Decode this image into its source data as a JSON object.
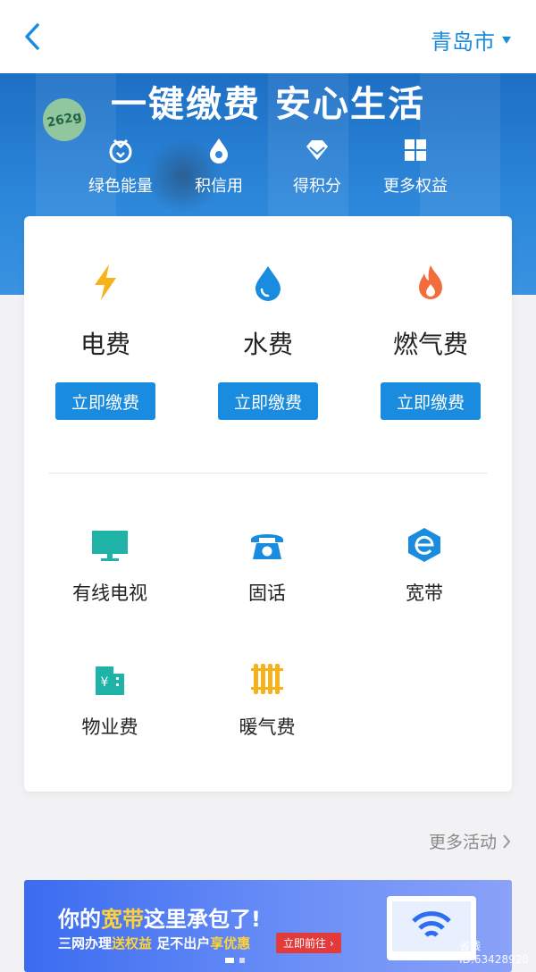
{
  "header": {
    "city": "青岛市"
  },
  "hero": {
    "badge": "262g",
    "title": "一键缴费  安心生活",
    "perks": [
      {
        "label": "绿色能量",
        "icon": "green-energy-icon"
      },
      {
        "label": "积信用",
        "icon": "credit-icon"
      },
      {
        "label": "得积分",
        "icon": "diamond-points-icon"
      },
      {
        "label": "更多权益",
        "icon": "grid-more-icon"
      }
    ]
  },
  "main_items": [
    {
      "label": "电费",
      "button": "立即缴费",
      "icon": "lightning-icon",
      "color": "#f6b21b"
    },
    {
      "label": "水费",
      "button": "立即缴费",
      "icon": "water-drop-icon",
      "color": "#1a8ce0"
    },
    {
      "label": "燃气费",
      "button": "立即缴费",
      "icon": "flame-icon",
      "color": "#f26c3c"
    }
  ],
  "grid_items": [
    {
      "label": "有线电视",
      "icon": "tv-icon"
    },
    {
      "label": "固话",
      "icon": "telephone-icon"
    },
    {
      "label": "宽带",
      "icon": "broadband-icon"
    },
    {
      "label": "物业费",
      "icon": "property-icon"
    },
    {
      "label": "暖气费",
      "icon": "radiator-icon"
    }
  ],
  "more_activities": "更多活动",
  "banner": {
    "title_pre": "你的",
    "title_highlight": "宽带",
    "title_post": "这里承包了!",
    "sub_pre": "三网办理",
    "sub_hl1": "送权益",
    "sub_mid": "  足不出户",
    "sub_hl2": "享优惠",
    "button": "立即前往 ›"
  },
  "watermark": {
    "line1": "省钱",
    "line2": "ID:63428928"
  },
  "colors": {
    "accent": "#1a8ce0",
    "teal": "#1fb3a8",
    "orange": "#f6b21b"
  }
}
